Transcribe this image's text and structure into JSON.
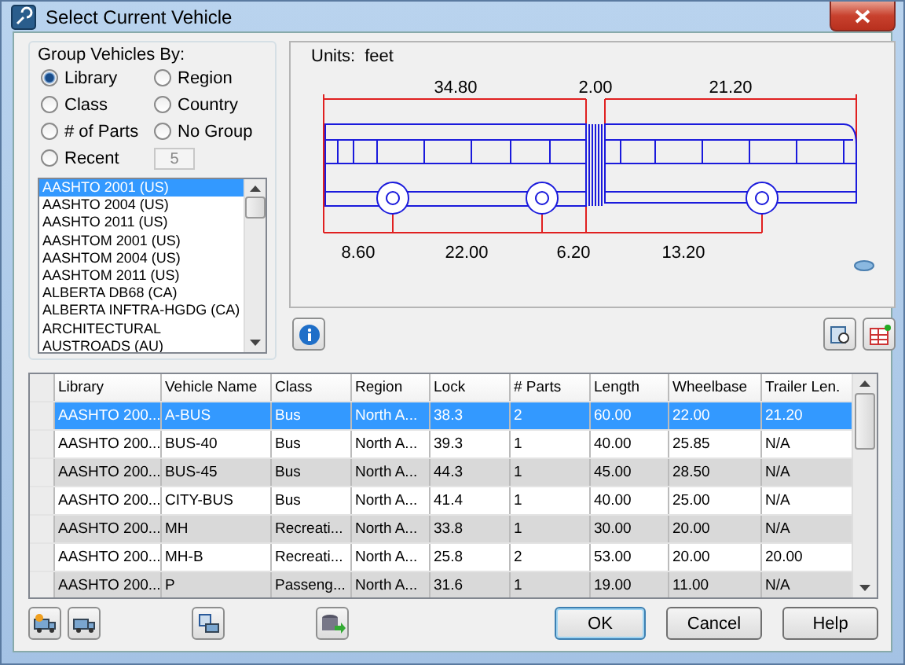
{
  "window": {
    "title": "Select Current Vehicle"
  },
  "group_by": {
    "label": "Group Vehicles By:",
    "options": [
      {
        "label": "Library",
        "selected": true
      },
      {
        "label": "Region",
        "selected": false
      },
      {
        "label": "Class",
        "selected": false
      },
      {
        "label": "Country",
        "selected": false
      },
      {
        "label": "# of Parts",
        "selected": false
      },
      {
        "label": "No Group",
        "selected": false
      },
      {
        "label": "Recent",
        "selected": false
      }
    ],
    "recent_count": {
      "value": "5",
      "disabled": true
    }
  },
  "libraries": [
    {
      "label": "AASHTO 2001 (US)",
      "selected": true
    },
    {
      "label": "AASHTO 2004 (US)",
      "selected": false
    },
    {
      "label": "AASHTO 2011 (US)",
      "selected": false
    },
    {
      "label": "AASHTOM 2001 (US)",
      "selected": false
    },
    {
      "label": "AASHTOM 2004 (US)",
      "selected": false
    },
    {
      "label": "AASHTOM 2011 (US)",
      "selected": false
    },
    {
      "label": "ALBERTA DB68 (CA)",
      "selected": false
    },
    {
      "label": "ALBERTA INFTRA-HGDG (CA)",
      "selected": false
    },
    {
      "label": "ARCHITECTURAL",
      "selected": false
    },
    {
      "label": "AUSTROADS (AU)",
      "selected": false
    }
  ],
  "preview": {
    "units_label": "Units:",
    "units": "feet",
    "top_dimensions": [
      "34.80",
      "2.00",
      "21.20"
    ],
    "bottom_dimensions": [
      "8.60",
      "22.00",
      "6.20",
      "13.20"
    ]
  },
  "table": {
    "columns": [
      "Library",
      "Vehicle Name",
      "Class",
      "Region",
      "Lock",
      "# Parts",
      "Length",
      "Wheelbase",
      "Trailer Len."
    ],
    "rows": [
      {
        "selected": true,
        "cells": [
          "AASHTO 200...",
          "A-BUS",
          "Bus",
          "North A...",
          "38.3",
          "2",
          "60.00",
          "22.00",
          "21.20"
        ]
      },
      {
        "selected": false,
        "cells": [
          "AASHTO 200...",
          "BUS-40",
          "Bus",
          "North A...",
          "39.3",
          "1",
          "40.00",
          "25.85",
          "N/A"
        ]
      },
      {
        "selected": false,
        "cells": [
          "AASHTO 200...",
          "BUS-45",
          "Bus",
          "North A...",
          "44.3",
          "1",
          "45.00",
          "28.50",
          "N/A"
        ]
      },
      {
        "selected": false,
        "cells": [
          "AASHTO 200...",
          "CITY-BUS",
          "Bus",
          "North A...",
          "41.4",
          "1",
          "40.00",
          "25.00",
          "N/A"
        ]
      },
      {
        "selected": false,
        "cells": [
          "AASHTO 200...",
          "MH",
          "Recreati...",
          "North A...",
          "33.8",
          "1",
          "30.00",
          "20.00",
          "N/A"
        ]
      },
      {
        "selected": false,
        "cells": [
          "AASHTO 200...",
          "MH-B",
          "Recreati...",
          "North A...",
          "25.8",
          "2",
          "53.00",
          "20.00",
          "20.00"
        ]
      },
      {
        "selected": false,
        "cells": [
          "AASHTO 200...",
          "P",
          "Passeng...",
          "North A...",
          "31.6",
          "1",
          "19.00",
          "11.00",
          "N/A"
        ]
      }
    ]
  },
  "buttons": [
    {
      "label": "OK",
      "default": true
    },
    {
      "label": "Cancel",
      "default": false
    },
    {
      "label": "Help",
      "default": false
    }
  ]
}
